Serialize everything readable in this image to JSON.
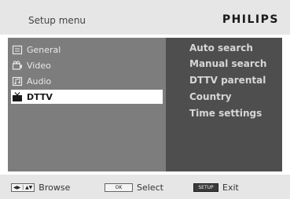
{
  "header": {
    "title": "Setup menu",
    "brand": "PHILIPS"
  },
  "left_menu": {
    "items": [
      {
        "label": "General",
        "icon": "general-icon"
      },
      {
        "label": "Video",
        "icon": "video-icon"
      },
      {
        "label": "Audio",
        "icon": "audio-icon"
      },
      {
        "label": "DTTV",
        "icon": "dttv-icon",
        "selected": true
      }
    ]
  },
  "right_menu": {
    "items": [
      "Auto search",
      "Manual search",
      "DTTV parental",
      "Country",
      "Time settings"
    ]
  },
  "footer": {
    "browse": {
      "key": "◀▶ | ▲▼",
      "label": "Browse"
    },
    "select": {
      "key": "OK",
      "label": "Select"
    },
    "exit": {
      "key": "SETUP",
      "label": "Exit"
    }
  },
  "colors": {
    "left_panel": "#7d7d7d",
    "right_panel": "#4e4e4e",
    "selected_bg": "#ffffff"
  }
}
